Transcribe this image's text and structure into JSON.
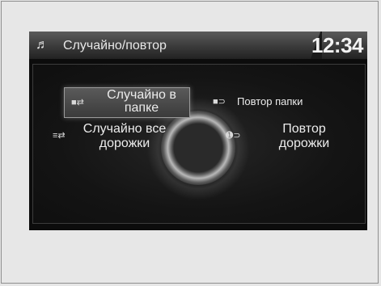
{
  "header": {
    "music_icon": "music-note-icon",
    "music_glyph": "♬",
    "title": "Случайно/повтор",
    "time": "12:34"
  },
  "options": {
    "shuffle_folder": {
      "label": "Случайно в папке",
      "icon": "folder-shuffle-icon",
      "glyph": "■⇄",
      "selected": true
    },
    "repeat_folder": {
      "label": "Повтор папки",
      "icon": "folder-repeat-icon",
      "glyph": "■⊃"
    },
    "shuffle_all": {
      "label": "Случайно все дорожки",
      "icon": "shuffle-all-icon",
      "glyph": "≡⇄"
    },
    "repeat_track": {
      "label": "Повтор дорожки",
      "icon": "repeat-track-icon",
      "glyph": "➊⊃"
    }
  },
  "colors": {
    "screen_bg": "#0c0c0c",
    "highlight": "#5a5a5a",
    "text": "#ececec"
  }
}
